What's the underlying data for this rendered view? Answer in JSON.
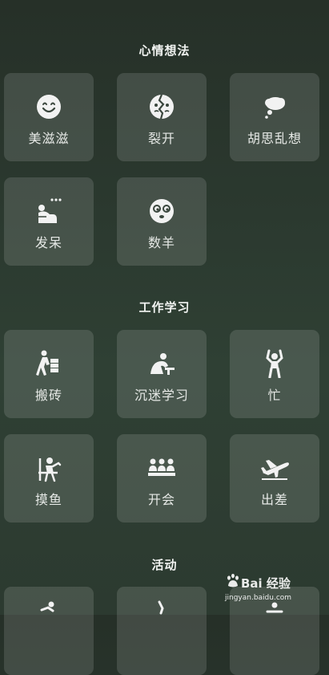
{
  "sections": [
    {
      "title": "心情想法",
      "items": [
        {
          "label": "美滋滋",
          "icon": "smiling-face-icon"
        },
        {
          "label": "裂开",
          "icon": "cracked-face-icon"
        },
        {
          "label": "胡思乱想",
          "icon": "thought-bubble-icon"
        },
        {
          "label": "发呆",
          "icon": "daydream-person-icon"
        },
        {
          "label": "数羊",
          "icon": "sleepy-face-icon"
        }
      ]
    },
    {
      "title": "工作学习",
      "items": [
        {
          "label": "搬砖",
          "icon": "carrying-bricks-icon"
        },
        {
          "label": "沉迷学习",
          "icon": "studying-person-icon"
        },
        {
          "label": "忙",
          "icon": "stressed-person-icon"
        },
        {
          "label": "摸鱼",
          "icon": "slacking-person-icon"
        },
        {
          "label": "开会",
          "icon": "meeting-icon"
        },
        {
          "label": "出差",
          "icon": "airplane-icon"
        }
      ]
    },
    {
      "title": "活动",
      "items": []
    }
  ],
  "watermark": {
    "brand": "Bai 经验",
    "url": "jingyan.baidu.com"
  },
  "colors": {
    "background_top": "#263028",
    "background_bottom": "#2f4034",
    "tile": "rgba(255,255,255,0.13)",
    "text": "#e6e9e6"
  }
}
